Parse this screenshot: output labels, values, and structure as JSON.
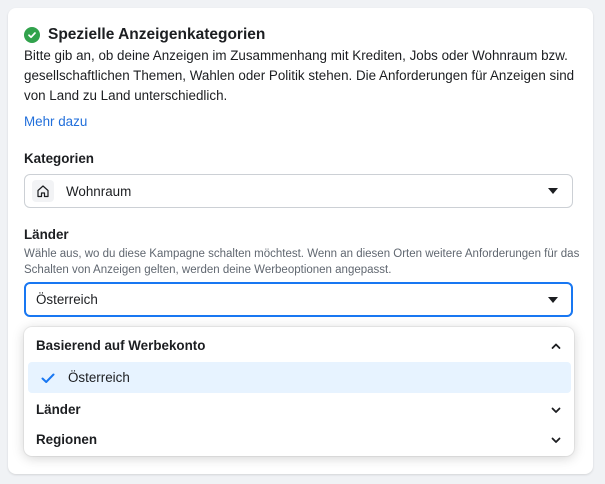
{
  "section": {
    "title": "Spezielle Anzeigenkategorien",
    "description": "Bitte gib an, ob deine Anzeigen im Zusammenhang mit Krediten, Jobs oder Wohnraum bzw. gesellschaftlichen Themen, Wahlen oder Politik stehen. Die Anforderungen für Anzeigen sind von Land zu Land unterschiedlich.",
    "learn_more": "Mehr dazu"
  },
  "categories": {
    "label": "Kategorien",
    "selected": "Wohnraum",
    "icon": "home-icon"
  },
  "countries": {
    "label": "Länder",
    "hint": "Wähle aus, wo du diese Kampagne schalten möchtest. Wenn an diesen Orten weitere Anforderungen für das Schalten von Anzeigen gelten, werden deine Werbeoptionen angepasst.",
    "selected": "Österreich"
  },
  "dropdown": {
    "sections": [
      {
        "label": "Basierend auf Werbekonto",
        "expanded": true
      },
      {
        "label": "Länder",
        "expanded": false
      },
      {
        "label": "Regionen",
        "expanded": false
      }
    ],
    "options": [
      {
        "label": "Österreich",
        "checked": true
      }
    ]
  },
  "colors": {
    "accent": "#1877f2",
    "link": "#216fdb",
    "success": "#31a24c",
    "selected_bg": "#e7f3ff"
  }
}
